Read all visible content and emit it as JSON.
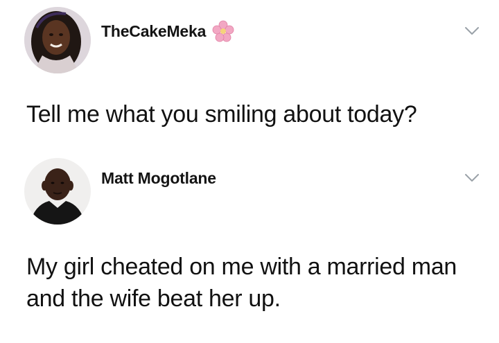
{
  "tweets": [
    {
      "username": "TheCakeMeka",
      "emoji": "cherry-blossom-icon",
      "text": "Tell me what you smiling about today?"
    },
    {
      "username": "Matt Mogotlane",
      "text": "My girl cheated on me with a married man and the wife beat her up."
    }
  ],
  "colors": {
    "text": "#111111",
    "chevron": "#9aa1a8",
    "flower": "#f2a7c3"
  }
}
